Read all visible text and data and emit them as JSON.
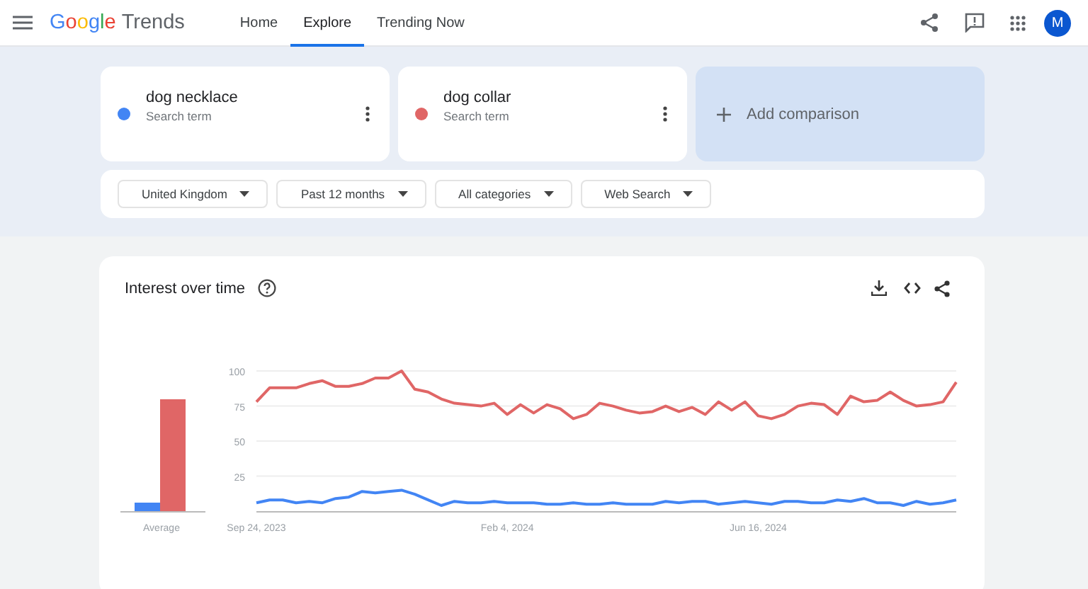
{
  "header": {
    "logo": {
      "brand": "Google",
      "product": "Trends"
    },
    "nav": [
      {
        "label": "Home",
        "selected": false
      },
      {
        "label": "Explore",
        "selected": true
      },
      {
        "label": "Trending Now",
        "selected": false
      }
    ],
    "avatar": {
      "initial": "M"
    }
  },
  "terms": [
    {
      "name": "dog necklace",
      "subtitle": "Search term",
      "color": "#4285f4"
    },
    {
      "name": "dog collar",
      "subtitle": "Search term",
      "color": "#e06666"
    }
  ],
  "add_comparison": {
    "label": "Add comparison"
  },
  "filters": [
    {
      "label": "United Kingdom"
    },
    {
      "label": "Past 12 months"
    },
    {
      "label": "All categories"
    },
    {
      "label": "Web Search"
    }
  ],
  "interest": {
    "title": "Interest over time",
    "average": {
      "chart_data": {
        "type": "bar",
        "categories": [
          "Average"
        ],
        "ylim": [
          0,
          100
        ],
        "series": [
          {
            "color": "#4285f4",
            "values": [
              6
            ]
          },
          {
            "color": "#e06666",
            "values": [
              79
            ]
          }
        ]
      }
    },
    "chart_data": {
      "type": "line",
      "ylim": [
        0,
        100
      ],
      "yticks": [
        {
          "value": 25,
          "label": "25"
        },
        {
          "value": 50,
          "label": "50"
        },
        {
          "value": 75,
          "label": "75"
        },
        {
          "value": 100,
          "label": "100"
        }
      ],
      "grid": true,
      "categories": [
        "Sep 24, 2023",
        null,
        null,
        null,
        null,
        null,
        null,
        null,
        null,
        null,
        null,
        null,
        null,
        null,
        null,
        null,
        null,
        null,
        null,
        "Feb 4, 2024",
        null,
        null,
        null,
        null,
        null,
        null,
        null,
        null,
        null,
        null,
        null,
        null,
        null,
        null,
        null,
        null,
        null,
        null,
        "Jun 16, 2024",
        null,
        null,
        null,
        null,
        null,
        null,
        null,
        null,
        null,
        null,
        null,
        null,
        null,
        null,
        null
      ],
      "series": [
        {
          "color": "#4285f4",
          "values": [
            6,
            8,
            8,
            6,
            7,
            6,
            9,
            10,
            14,
            13,
            14,
            15,
            12,
            8,
            4,
            7,
            6,
            6,
            7,
            6,
            6,
            6,
            5,
            5,
            6,
            5,
            5,
            6,
            5,
            5,
            5,
            7,
            6,
            7,
            7,
            5,
            6,
            7,
            6,
            5,
            7,
            7,
            6,
            6,
            8,
            7,
            9,
            6,
            6,
            4,
            7,
            5,
            6,
            8
          ]
        },
        {
          "color": "#e06666",
          "values": [
            78,
            88,
            88,
            88,
            91,
            93,
            89,
            89,
            91,
            95,
            95,
            100,
            87,
            85,
            80,
            77,
            76,
            75,
            77,
            69,
            76,
            70,
            76,
            73,
            66,
            69,
            77,
            75,
            72,
            70,
            71,
            75,
            71,
            74,
            69,
            78,
            72,
            78,
            68,
            66,
            69,
            75,
            77,
            76,
            69,
            82,
            78,
            79,
            85,
            79,
            75,
            76,
            78,
            92
          ]
        }
      ]
    }
  }
}
